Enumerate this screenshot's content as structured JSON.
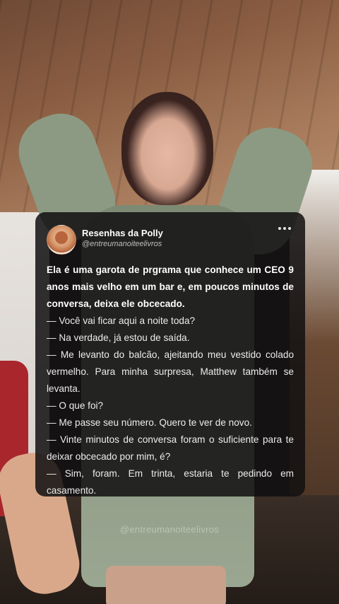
{
  "post": {
    "author_name": "Resenhas da Polly",
    "author_handle": "@entreumanoiteelivros",
    "avatar_icon": "profile-avatar",
    "more_icon": "more-dots-icon",
    "lead": "Ela é uma garota de prgrama que conhece um CEO 9 anos mais velho em um bar e, em poucos minutos de conversa, deixa ele obcecado.",
    "lines": [
      "— Você vai ficar aqui a noite toda?",
      "— Na verdade, já estou de saída.",
      "— Me levanto do balcão, ajeitando meu vestido colado vermelho. Para minha surpresa, Matthew também se levanta.",
      "— O que foi?",
      "— Me passe seu número. Quero te ver de novo.",
      "— Vinte minutos de conversa foram o suficiente para te deixar obcecado por mim, é?",
      "— Sim, foram. Em trinta, estaria te pedindo em casamento."
    ]
  },
  "watermark": "@entreumanoiteelivros",
  "colors": {
    "card_background": "#121012",
    "text_primary": "#ececec",
    "text_secondary": "#bdbdbd"
  }
}
